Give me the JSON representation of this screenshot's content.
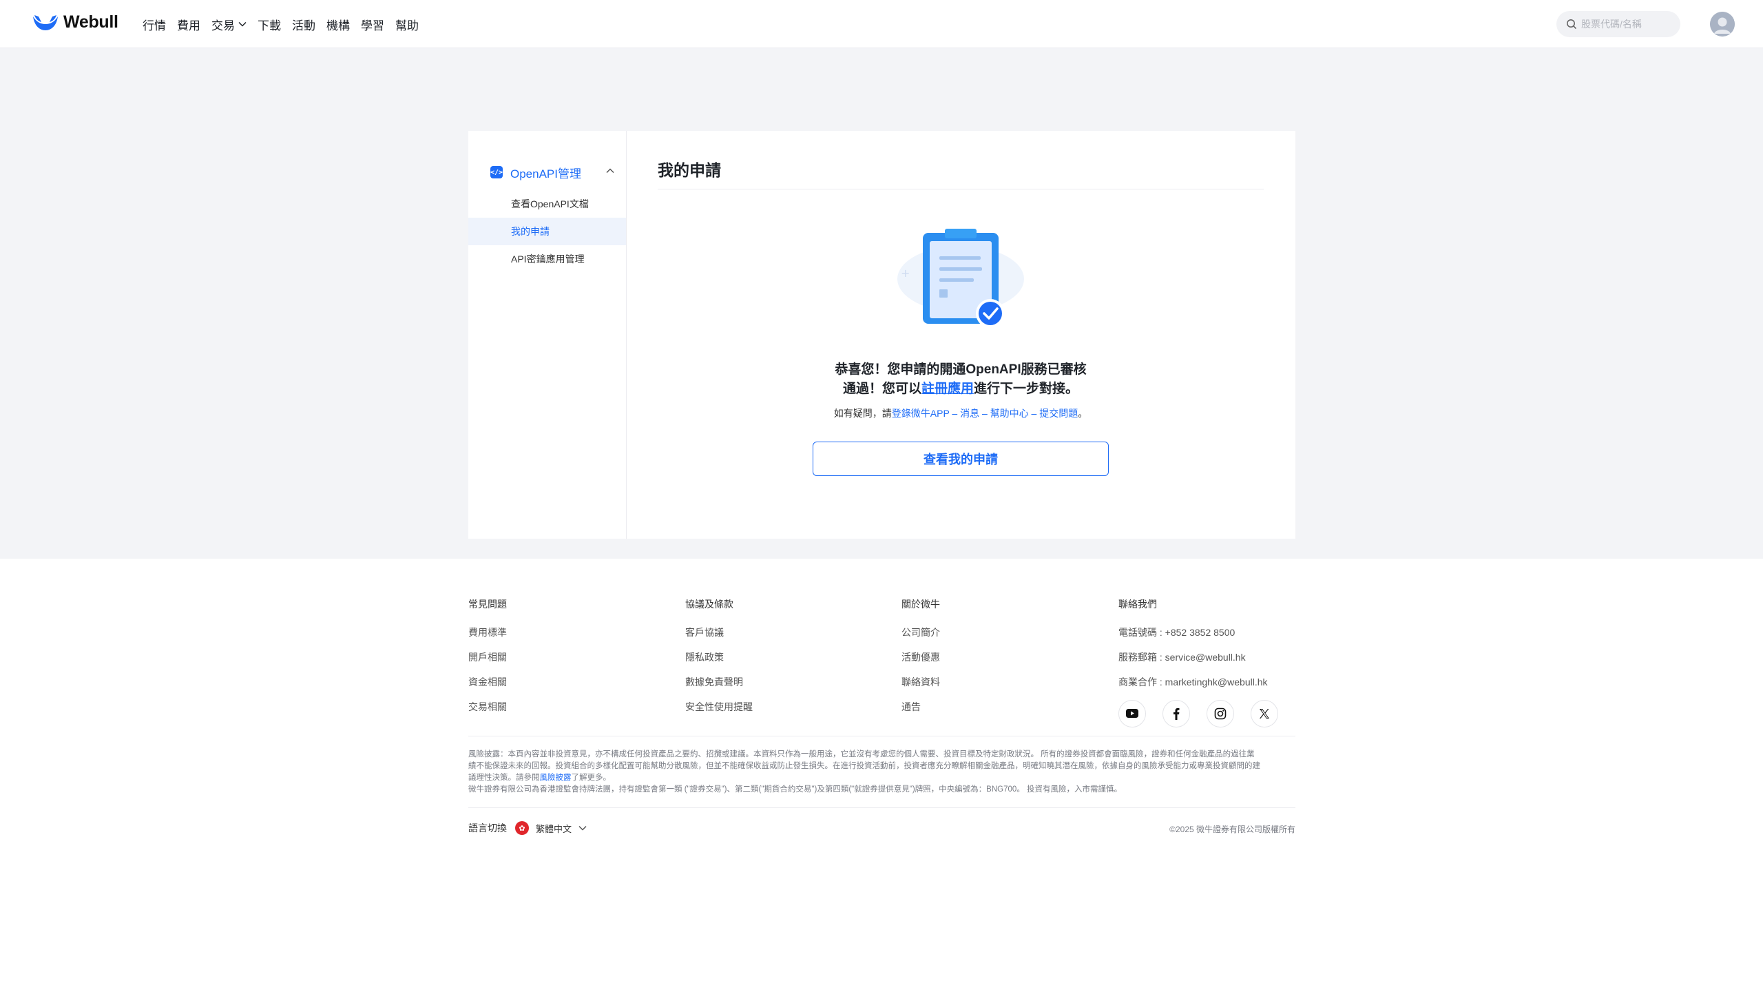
{
  "header": {
    "brand": "Webull",
    "nav": [
      {
        "label": "行情"
      },
      {
        "label": "費用"
      },
      {
        "label": "交易",
        "has_dropdown": true
      },
      {
        "label": "下載"
      },
      {
        "label": "活動"
      },
      {
        "label": "機構"
      },
      {
        "label": "學習"
      },
      {
        "label": "幫助"
      }
    ],
    "search_placeholder": "股票代碼/名稱"
  },
  "sidebar": {
    "group_label": "OpenAPI管理",
    "group_icon": "code-icon",
    "items": [
      {
        "label": "查看OpenAPI文檔",
        "active": false
      },
      {
        "label": "我的申請",
        "active": true
      },
      {
        "label": "API密鑰應用管理",
        "active": false
      }
    ]
  },
  "main": {
    "title": "我的申請",
    "message_part1": "恭喜您！您申請的開通OpenAPI服務已審核",
    "message_part2": "通過！您可以",
    "message_link": "註冊應用",
    "message_part3": "進行下一步對接。",
    "hint_prefix": "如有疑問，請",
    "hint_link": "登錄微牛APP – 消息 – 幫助中心 – 提交問題",
    "hint_suffix": "。",
    "button": "查看我的申請"
  },
  "footer": {
    "columns": [
      {
        "title": "常見問題",
        "items": [
          "費用標準",
          "開戶相關",
          "資金相關",
          "交易相關"
        ]
      },
      {
        "title": "協議及條款",
        "items": [
          "客戶協議",
          "隱私政策",
          "數據免責聲明",
          "安全性使用提醒"
        ]
      },
      {
        "title": "關於微牛",
        "items": [
          "公司簡介",
          "活動優惠",
          "聯絡資料",
          "通告"
        ]
      },
      {
        "title": "聯絡我們",
        "items": [
          "電話號碼 : +852 3852 8500",
          "服務郵箱 : service@webull.hk",
          "商業合作 : marketinghk@webull.hk"
        ]
      }
    ],
    "social": [
      "youtube-icon",
      "facebook-icon",
      "instagram-icon",
      "x-icon"
    ],
    "disclaimer_line1": "風險披露：本頁內容並非投資意見，亦不構成任何投資產品之要約、招攬或建議。本資料只作為一般用途，它並沒有考慮您的個人需要、投資目標及特定財政狀況。 所有的證券投資都會面臨風險，證券和任何金融產品的過往業",
    "disclaimer_line2": "績不能保證未來的回報。投資組合的多樣化配置可能幫助分散風險，但並不能確保收益或防止發生損失。在進行投資活動前，投資者應充分瞭解相關金融產品，明確知曉其潛在風險，依據自身的風險承受能力或專業投資顧問的建",
    "disclaimer_line3_prefix": "議理性決策。請參閱",
    "disclaimer_line3_link": "風險披露",
    "disclaimer_line3_suffix": "了解更多。",
    "disclaimer_line4": "微牛證券有限公司為香港證監會持牌法團，持有證監會第一類 (\"證券交易\")、第二類(\"期貨合約交易\")及第四類(\"就證券提供意見\")牌照，中央編號為：BNG700。 投資有風險，入市需謹慎。",
    "language_label": "語言切換",
    "language_value": "繁體中文",
    "copyright": "©2025 微牛證券有限公司版權所有"
  },
  "colors": {
    "accent": "#1e6cf6",
    "page_bg": "#f3f4f7",
    "text": "#1f2329"
  }
}
